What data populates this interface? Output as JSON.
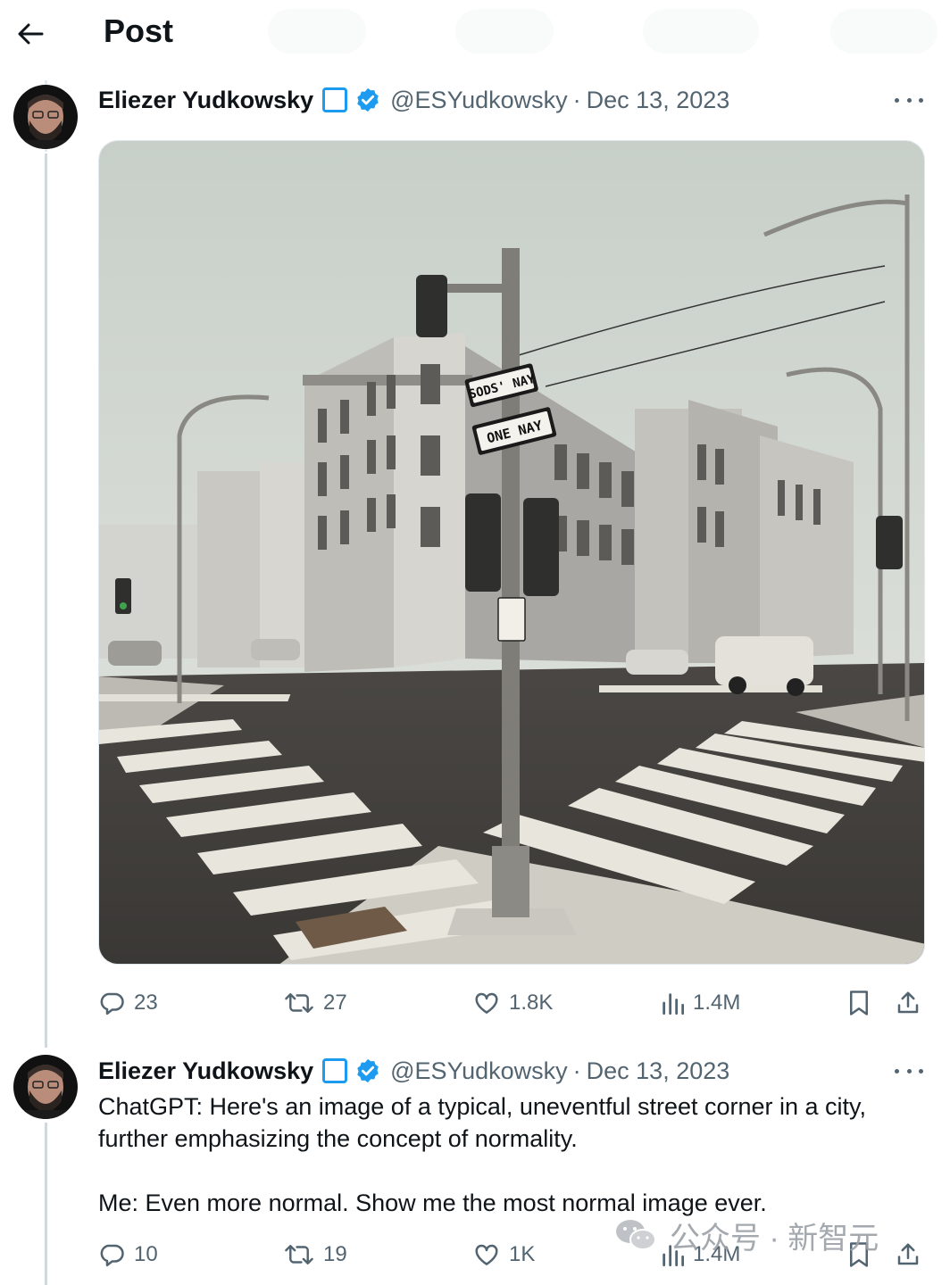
{
  "header": {
    "title": "Post"
  },
  "tweets": [
    {
      "author": "Eliezer Yudkowsky",
      "handle": "@ESYudkowsky",
      "separator": "·",
      "date": "Dec 13, 2023",
      "stats": {
        "replies": "23",
        "reposts": "27",
        "likes": "1.8K",
        "views": "1.4M"
      }
    },
    {
      "author": "Eliezer Yudkowsky",
      "handle": "@ESYudkowsky",
      "separator": "·",
      "date": "Dec 13, 2023",
      "text": "ChatGPT:  Here's an image of a typical, uneventful street corner in a city, further emphasizing the concept of normality.\n\nMe:  Even more normal.  Show me the most normal image ever.",
      "stats": {
        "replies": "10",
        "reposts": "19",
        "likes": "1K",
        "views": "1.4M"
      }
    }
  ],
  "photo_signs": {
    "top": "SODS' NAY",
    "bottom": "ONE NAY"
  },
  "watermark": {
    "text": "公众号 · 新智元"
  },
  "colors": {
    "accent": "#1d9bf0",
    "secondary_text": "#536471",
    "thread_line": "#cfd9de"
  }
}
